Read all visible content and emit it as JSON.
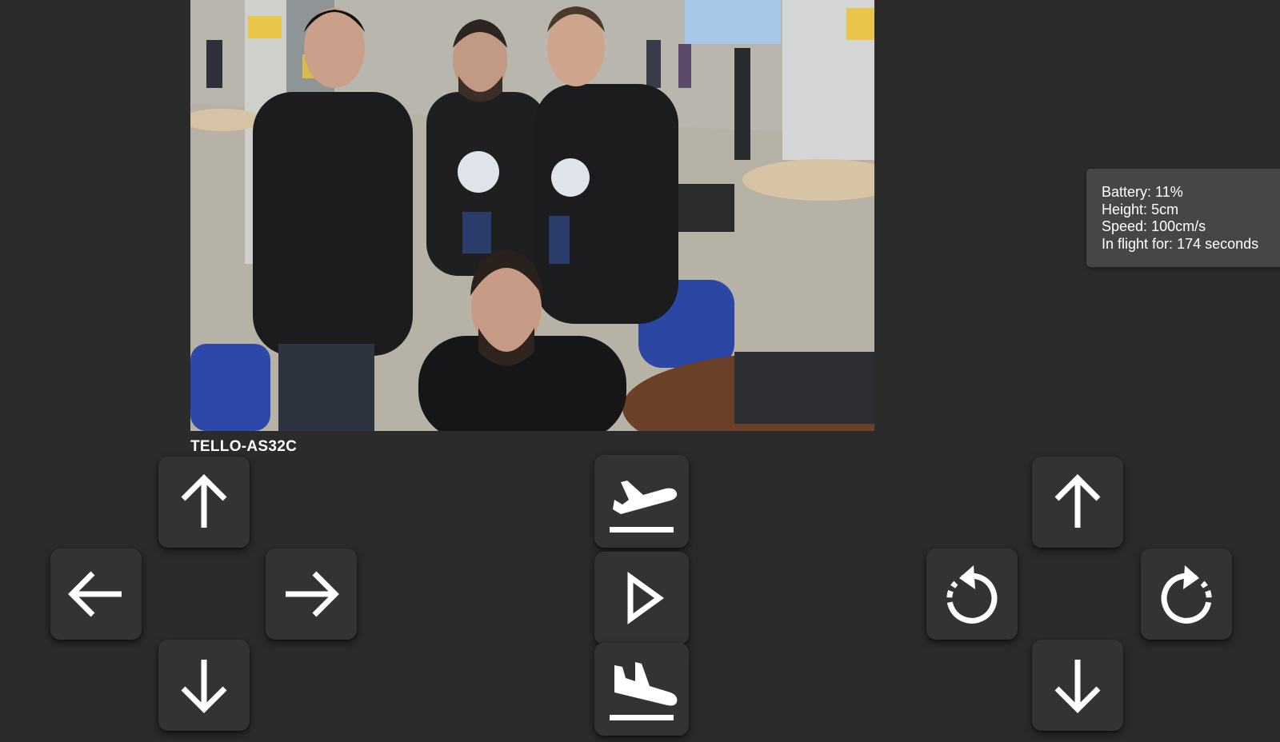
{
  "drone": {
    "name": "TELLO-AS32C"
  },
  "telemetry": {
    "battery_label": "Battery:",
    "battery_value": "11%",
    "height_label": "Height:",
    "height_value": "5cm",
    "speed_label": "Speed:",
    "speed_value": "100cm/s",
    "flight_label": "In flight for:",
    "flight_value": "174 seconds"
  },
  "controls": {
    "movement": [
      "arrow-up-icon",
      "arrow-left-icon",
      "arrow-right-icon",
      "arrow-down-icon"
    ],
    "flight": [
      "takeoff-icon",
      "play-icon",
      "land-icon"
    ],
    "altitude_rotation": [
      "arrow-up-icon",
      "rotate-ccw-icon",
      "rotate-cw-icon",
      "arrow-down-icon"
    ]
  },
  "colors": {
    "background": "#2b2b2b",
    "button": "#333333",
    "panel": "#464646",
    "icon": "#ffffff"
  }
}
